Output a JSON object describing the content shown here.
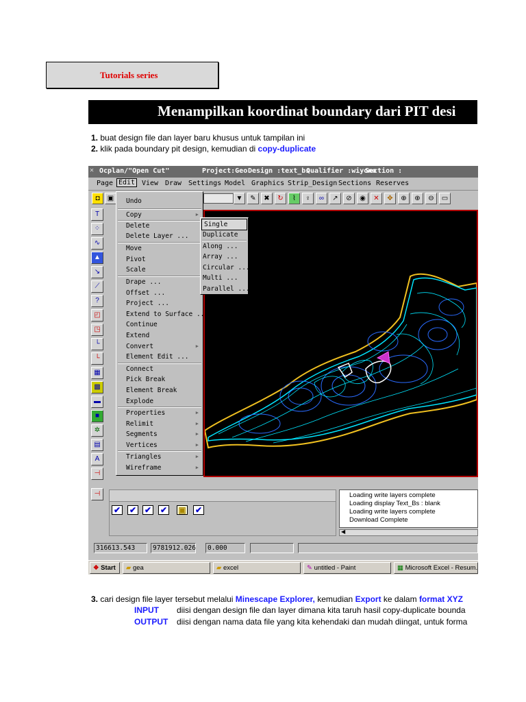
{
  "header": {
    "series_label": "Tutorials series",
    "title": "Menampilkan koordinat boundary dari PIT desi"
  },
  "steps": {
    "step1_num": "1.",
    "step1_text": "buat design file dan layer baru khusus untuk tampilan ini",
    "step2_num": "2.",
    "step2_text": "klik pada boundary pit design, kemudian di ",
    "step2_link": "copy-duplicate",
    "step3_num": "3.",
    "step3_text_a": "cari design file layer tersebut melalui ",
    "step3_link1": "Minescape Explorer,",
    "step3_text_b": " kemudian ",
    "step3_link2": "Export",
    "step3_text_c": " ke dalam ",
    "step3_link3": "format XYZ",
    "input_label": "INPUT",
    "input_text": "diisi dengan design file dan layer dimana kita taruh hasil copy-duplicate bounda",
    "output_label": "OUTPUT",
    "output_text": "diisi dengan nama data file yang kita kehendaki dan mudah diingat, untuk forma"
  },
  "app": {
    "titlebar": {
      "app_name": "Ocplan/\"Open Cut\"",
      "project": "Project:Geo",
      "design": "Design :text_bs",
      "qualifier": "Qualifier :wiyono",
      "section": "Section :"
    },
    "menubar": [
      "Page",
      "Edit",
      "View",
      "Draw",
      "Settings",
      "Model",
      "Graphics",
      "Strip_Design",
      "Sections",
      "Reserves"
    ],
    "edit_menu": [
      "Undo",
      "Copy",
      "Delete",
      "Delete Layer ...",
      "Move",
      "Pivot",
      "Scale",
      "Drape ...",
      "Offset ...",
      "Project ...",
      "Extend to Surface ...",
      "Continue",
      "Extend",
      "Convert",
      "Element Edit ...",
      "Connect",
      "Pick Break",
      "Element Break",
      "Explode",
      "Properties",
      "Relimit",
      "Segments",
      "Vertices",
      "Triangles",
      "Wireframe"
    ],
    "copy_submenu": [
      "Single",
      "Duplicate",
      "Along ...",
      "Array ...",
      "Circular ...",
      "Multi ...",
      "Parallel ..."
    ],
    "log_lines": [
      "Loading write layers complete",
      "Loading display Text_Bs : blank",
      "Loading write layers complete",
      "Download Complete"
    ],
    "status": {
      "x": "316613.543",
      "y": "9781912.026",
      "z": "0.000",
      "f4": "",
      "f5": ""
    },
    "taskbar": {
      "start": "Start",
      "task1": "gea",
      "task2": "excel",
      "task3": "untitled - Paint",
      "task4": "Microsoft Excel - Resum..."
    }
  },
  "colors": {
    "link_blue": "#1a1aff",
    "series_red": "#e00000",
    "canvas_black": "#000000",
    "contour_cyan": "#00e5ff",
    "contour_blue": "#2a6bff",
    "boundary_yellow": "#f0c020"
  }
}
